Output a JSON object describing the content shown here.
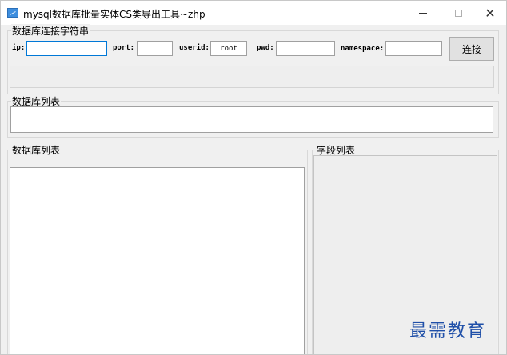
{
  "window": {
    "title": "mysql数据库批量实体CS类导出工具~zhp",
    "controls": {
      "minimize": "—",
      "maximize": "□",
      "close": "✕"
    }
  },
  "connection": {
    "group_label": "数据库连接字符串",
    "ip": {
      "label": "ip:",
      "value": ""
    },
    "port": {
      "label": "port:",
      "value": ""
    },
    "userid": {
      "label": "userid:",
      "value": "root"
    },
    "pwd": {
      "label": "pwd:",
      "value": ""
    },
    "namespace": {
      "label": "namespace:",
      "value": ""
    },
    "connect_button": "连接",
    "status_text": ""
  },
  "database_select": {
    "group_label": "数据库列表"
  },
  "table_list": {
    "group_label": "数据库列表"
  },
  "field_list": {
    "group_label": "字段列表"
  },
  "watermark": "最需教育"
}
